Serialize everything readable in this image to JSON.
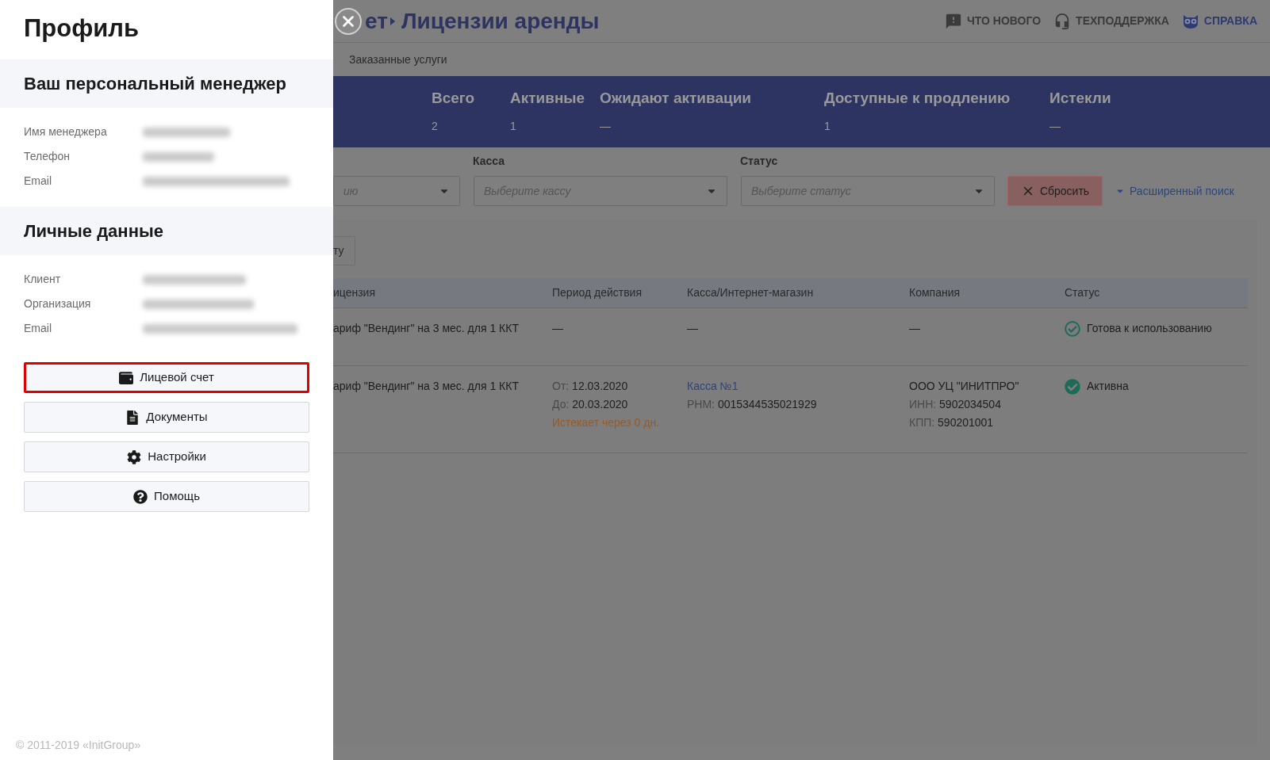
{
  "drawer": {
    "title": "Профиль",
    "sections": [
      {
        "heading": "Ваш персональный менеджер",
        "fields": [
          {
            "label": "Имя менеджера"
          },
          {
            "label": "Телефон"
          },
          {
            "label": "Email"
          }
        ]
      },
      {
        "heading": "Личные данные",
        "fields": [
          {
            "label": "Клиент"
          },
          {
            "label": "Организация"
          },
          {
            "label": "Email"
          }
        ]
      }
    ],
    "buttons": [
      {
        "label": "Лицевой счет",
        "kind": "wallet",
        "highlighted": true
      },
      {
        "label": "Документы",
        "kind": "document",
        "highlighted": false
      },
      {
        "label": "Настройки",
        "kind": "gear",
        "highlighted": false
      },
      {
        "label": "Помощь",
        "kind": "help",
        "highlighted": false
      }
    ],
    "footer": "© 2011-2019 «InitGroup»"
  },
  "page": {
    "breadcrumb": "ет",
    "title": "Лицензии аренды",
    "header_links": [
      {
        "label": "ЧТО НОВОГО",
        "kind": "feedback",
        "selected": false
      },
      {
        "label": "ТЕХПОДДЕРЖКА",
        "kind": "headset",
        "selected": false
      },
      {
        "label": "СПРАВКА",
        "kind": "owl",
        "selected": true
      }
    ],
    "subnav": "Заказанные услуги",
    "stats": [
      {
        "label": "Всего",
        "value": "2"
      },
      {
        "label": "Активные",
        "value": "1"
      },
      {
        "label": "Ожидают активации",
        "value": "—"
      },
      {
        "label": "Доступные к продлению",
        "value": "1"
      },
      {
        "label": "Истекли",
        "value": "—"
      }
    ],
    "filters": [
      {
        "placeholder": "ию"
      },
      {
        "label": "Касса",
        "placeholder": "Выберите кассу"
      },
      {
        "label": "Статус",
        "placeholder": "Выберите статус"
      }
    ],
    "reset_button": "Сбросить",
    "advanced_search": "Расширенный поиск",
    "partial_button": "ту",
    "table": {
      "columns": [
        "ицензия",
        "Период действия",
        "Касса/Интернет-магазин",
        "Компания",
        "Статус"
      ],
      "rows": [
        {
          "license": "ариф \"Вендинг\" на 3 мес. для 1 ККТ",
          "period": [
            {
              "text": "—"
            }
          ],
          "kassa": [
            {
              "text": "—"
            }
          ],
          "company": [
            {
              "text": "—"
            }
          ],
          "status": {
            "text": "Готова к использованию",
            "kind": "ready"
          }
        },
        {
          "license": "ариф \"Вендинг\" на 3 мес. для 1 ККТ",
          "period": [
            {
              "label": "От:",
              "text": "12.03.2020"
            },
            {
              "label": "До:",
              "text": "20.03.2020"
            },
            {
              "text": "Истекает через 0 дн.",
              "kind": "warning"
            }
          ],
          "kassa": [
            {
              "text": "Касса №1",
              "kind": "link"
            },
            {
              "label": "РНМ:",
              "text": "0015344535021929"
            }
          ],
          "company": [
            {
              "text": "ООО УЦ \"ИНИТПРО\""
            },
            {
              "label": "ИНН:",
              "text": "5902034504"
            },
            {
              "label": "КПП:",
              "text": "590201001"
            }
          ],
          "status": {
            "text": "Активна",
            "kind": "active"
          }
        }
      ]
    }
  }
}
